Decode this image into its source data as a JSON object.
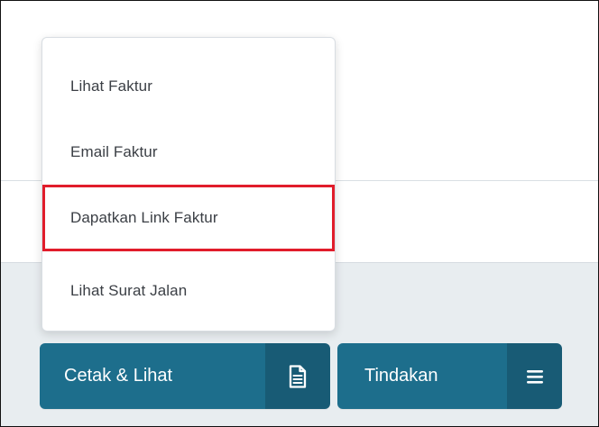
{
  "menu": {
    "items": [
      {
        "label": "Lihat Faktur"
      },
      {
        "label": "Email Faktur"
      },
      {
        "label": "Dapatkan Link Faktur"
      },
      {
        "label": "Lihat Surat Jalan"
      }
    ]
  },
  "buttons": {
    "print_view": {
      "label": "Cetak & Lihat",
      "icon": "document-icon"
    },
    "actions": {
      "label": "Tindakan",
      "icon": "hamburger-menu-icon"
    }
  },
  "colors": {
    "button_primary": "#1d6e8c",
    "button_icon_bg": "#185b75",
    "highlight": "#e11d2b",
    "page_bottom": "#e8edf0"
  }
}
